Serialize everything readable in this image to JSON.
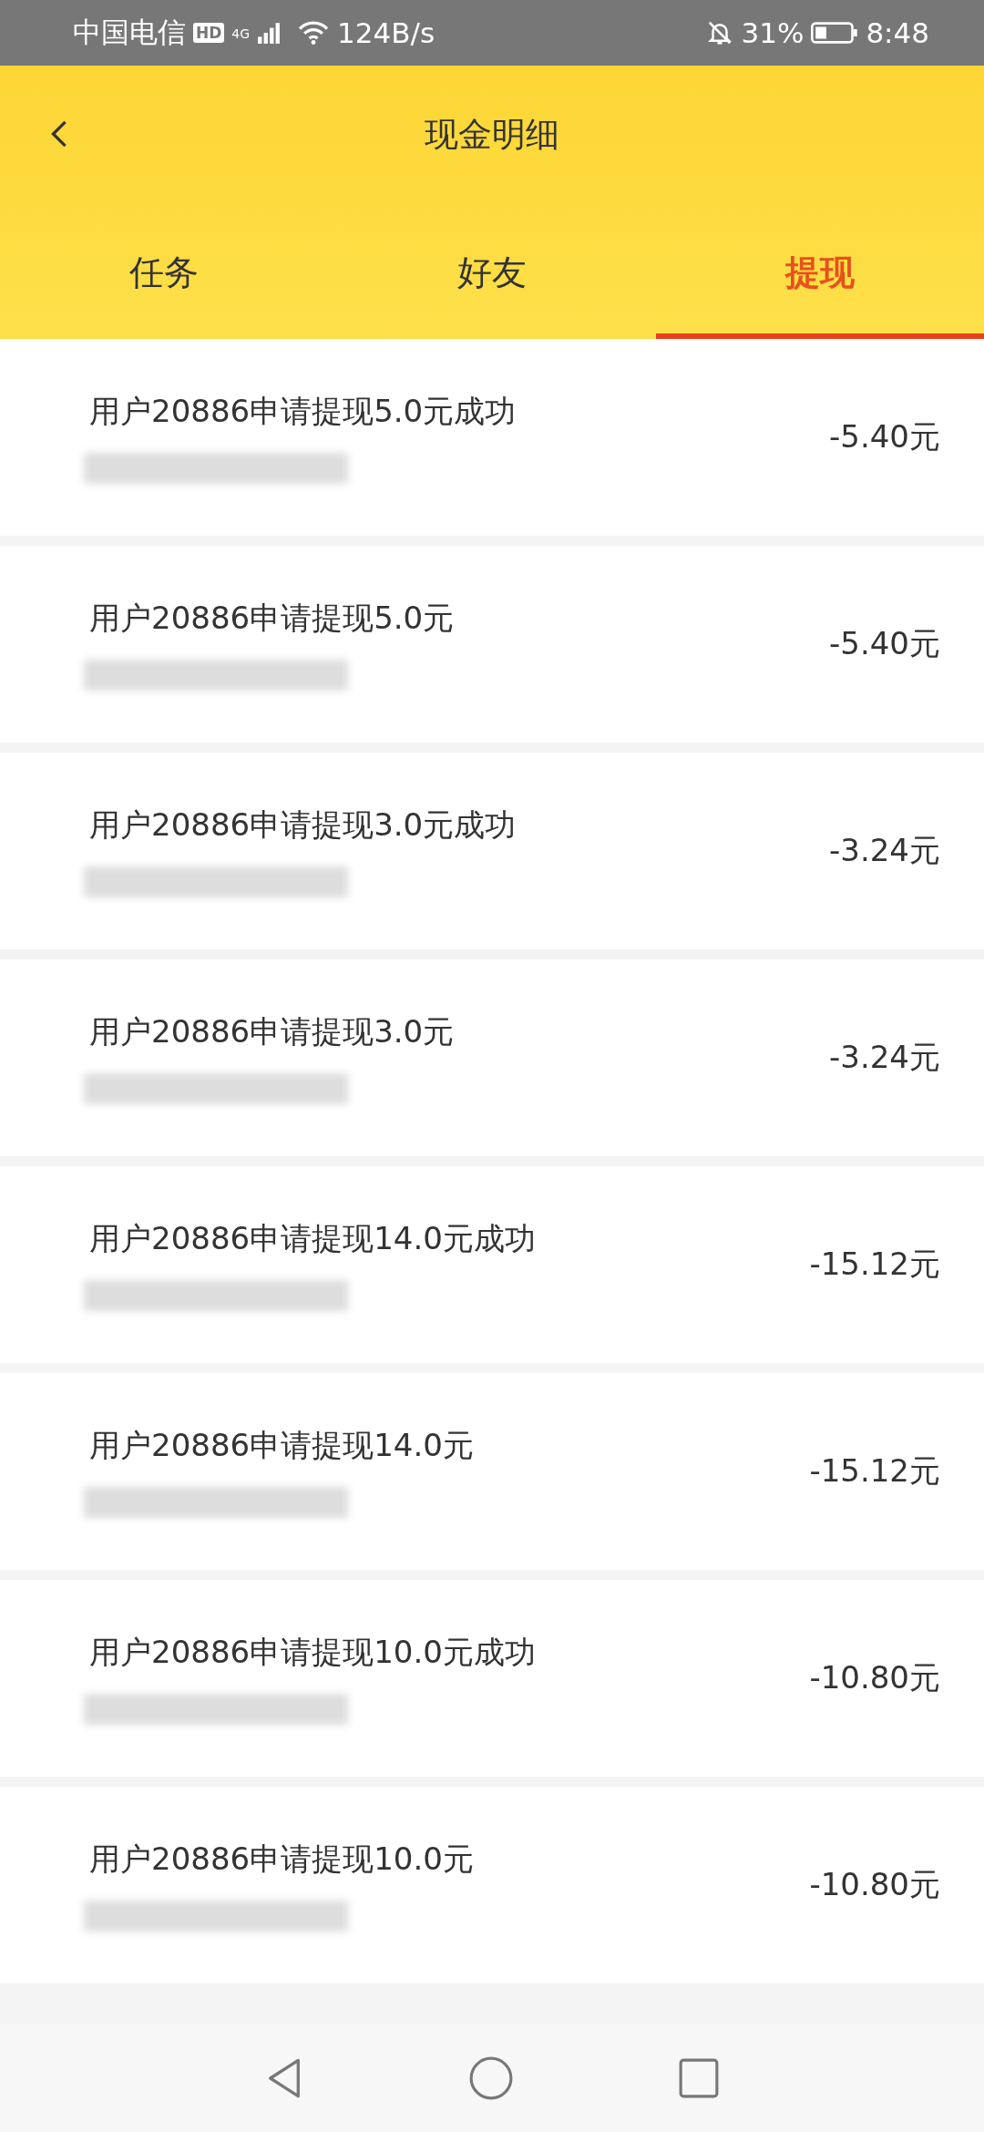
{
  "status_bar": {
    "carrier": "中国电信",
    "hd_badge": "HD",
    "network": "4G",
    "speed": "124B/s",
    "battery": "31%",
    "time": "8:48"
  },
  "header": {
    "title": "现金明细"
  },
  "tabs": [
    {
      "label": "任务",
      "selected": false
    },
    {
      "label": "好友",
      "selected": false
    },
    {
      "label": "提现",
      "selected": true
    }
  ],
  "records": [
    {
      "title": "用户20886申请提现5.0元成功",
      "amount": "-5.40元",
      "date_blurred": true
    },
    {
      "title": "用户20886申请提现5.0元",
      "amount": "-5.40元",
      "date_blurred": true
    },
    {
      "title": "用户20886申请提现3.0元成功",
      "amount": "-3.24元",
      "date_blurred": true
    },
    {
      "title": "用户20886申请提现3.0元",
      "amount": "-3.24元",
      "date_blurred": true
    },
    {
      "title": "用户20886申请提现14.0元成功",
      "amount": "-15.12元",
      "date_blurred": true
    },
    {
      "title": "用户20886申请提现14.0元",
      "amount": "-15.12元",
      "date_blurred": true
    },
    {
      "title": "用户20886申请提现10.0元成功",
      "amount": "-10.80元",
      "date_blurred": true
    },
    {
      "title": "用户20886申请提现10.0元",
      "amount": "-10.80元",
      "date_blurred": true
    }
  ]
}
